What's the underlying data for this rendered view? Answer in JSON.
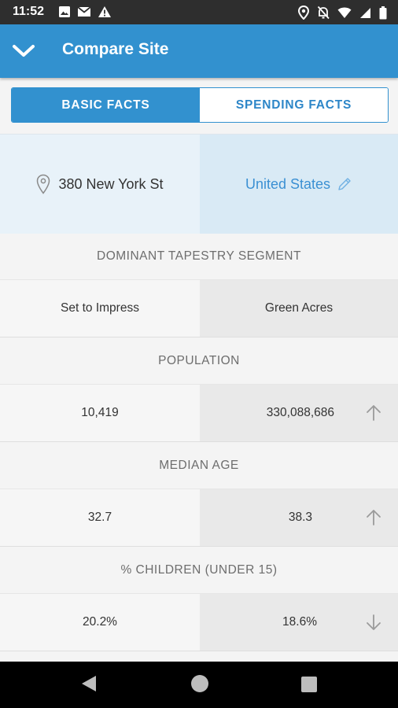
{
  "status_bar": {
    "time": "11:52"
  },
  "header": {
    "title": "Compare Site"
  },
  "tabs": [
    {
      "label": "BASIC FACTS",
      "active": true
    },
    {
      "label": "SPENDING FACTS",
      "active": false
    }
  ],
  "sites": {
    "left": "380 New York St",
    "right": "United States"
  },
  "sections": [
    {
      "label": "DOMINANT TAPESTRY SEGMENT",
      "left": "Set to Impress",
      "right": "Green Acres",
      "arrow": ""
    },
    {
      "label": "POPULATION",
      "left": "10,419",
      "right": "330,088,686",
      "arrow": "up"
    },
    {
      "label": "MEDIAN AGE",
      "left": "32.7",
      "right": "38.3",
      "arrow": "up"
    },
    {
      "label": "% CHILDREN (UNDER 15)",
      "left": "20.2%",
      "right": "18.6%",
      "arrow": "down"
    }
  ],
  "colors": {
    "primary": "#3291cf",
    "link": "#3b90d3"
  },
  "icons": {
    "status_left": [
      "image-icon",
      "gmail-icon",
      "warning-icon"
    ],
    "status_right": [
      "location-icon",
      "notifications-off-icon",
      "wifi-icon",
      "signal-icon",
      "battery-icon"
    ],
    "header": "chevron-down-icon",
    "address": "location-pin-icon",
    "edit": "pencil-icon",
    "nav": [
      "back-icon",
      "home-icon",
      "recents-icon"
    ]
  }
}
